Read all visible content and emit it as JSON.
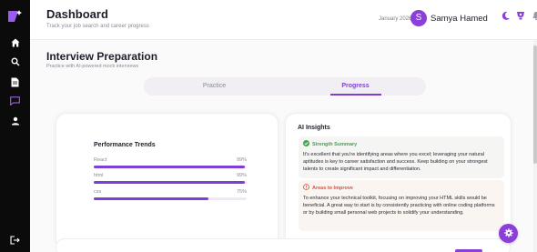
{
  "header": {
    "title": "Dashboard",
    "subtitle": "Track your job search and career progress",
    "date": "January 2026",
    "avatar_initial": "S",
    "user_name": "Samya Hamed"
  },
  "sidebar": {
    "items": [
      {
        "icon": "home-icon"
      },
      {
        "icon": "search-icon"
      },
      {
        "icon": "document-icon"
      },
      {
        "icon": "chat-icon",
        "active": true
      },
      {
        "icon": "user-icon"
      }
    ],
    "logout_icon": "logout-icon"
  },
  "page": {
    "title": "Interview Preparation",
    "subtitle": "Practice with AI-powered mock interviews",
    "tabs": [
      {
        "label": "Practice",
        "active": false
      },
      {
        "label": "Progress",
        "active": true
      }
    ]
  },
  "performance": {
    "title": "Performance Trends",
    "skills": [
      {
        "name": "React",
        "value_label": "99%",
        "value": 0.99
      },
      {
        "name": "html",
        "value_label": "99%",
        "value": 0.99
      },
      {
        "name": "css",
        "value_label": "75%",
        "value": 0.75
      }
    ]
  },
  "insights": {
    "title": "AI Insights",
    "strength": {
      "heading": "Strength Summary",
      "text": "It's excellent that you're identifying areas where you excel; leveraging your natural aptitudes is key to career satisfaction and success. Keep building on your strongest talents to create significant impact and differentiation."
    },
    "improve": {
      "heading": "Areas to Improve",
      "text": "To enhance your technical toolkit, focusing on improving your HTML skills would be beneficial. A great way to start is by consistently practicing with online coding platforms or by building small personal web projects to solidify your understanding."
    }
  },
  "colors": {
    "accent": "#8b3fd9",
    "sidebar": "#0b0b0b",
    "success": "#3aa94a",
    "danger": "#e24d3b"
  }
}
